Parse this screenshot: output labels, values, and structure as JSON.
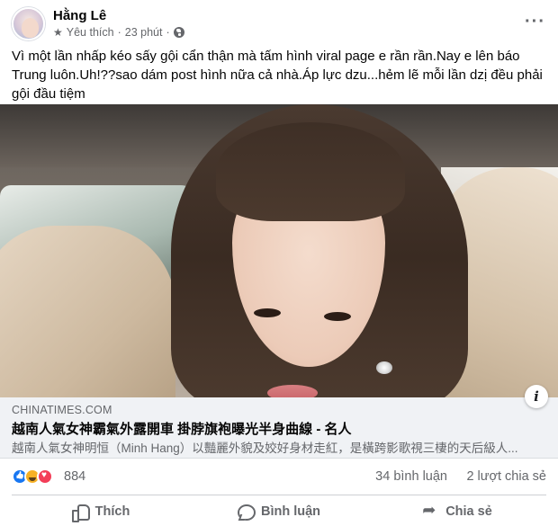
{
  "post": {
    "author": "Hằng Lê",
    "audience_label": "Yêu thích",
    "time": "23 phút",
    "separator": "·",
    "more_label": "···",
    "text": "Vì một lần nhấp kéo sấy gội cẩn thận mà tấm hình  viral page e rần rần.Nay e lên báo Trung luôn.Uh!??sao dám post hình nữa cả nhà.Áp lực dzu...hẻm lẽ mỗi lần dzị đều phải gội đầu tiệm"
  },
  "link_preview": {
    "domain": "CHINATIMES.COM",
    "title": "越南人氣女神霸氣外露開車 掛脖旗袍曝光半身曲線 - 名人",
    "description": "越南人氣女神明恒（Minh Hang）以豔麗外貌及姣好身材走紅，是橫跨影歌視三棲的天后級人...",
    "info_label": "i"
  },
  "stats": {
    "reaction_count": "884",
    "comments": "34 bình luận",
    "shares": "2 lượt chia sẻ"
  },
  "actions": {
    "like": "Thích",
    "comment": "Bình luận",
    "share": "Chia sẻ"
  },
  "icons": {
    "audience": "star-icon",
    "privacy": "globe-icon",
    "emoji": "worried-face-icon",
    "reactions": [
      "like-icon",
      "haha-icon",
      "love-icon"
    ]
  },
  "colors": {
    "text_primary": "#050505",
    "text_secondary": "#65676b",
    "link_card_bg": "#f0f2f5",
    "like_blue": "#1877f2",
    "love_red": "#f33e58",
    "haha_yellow": "#f7b125"
  }
}
